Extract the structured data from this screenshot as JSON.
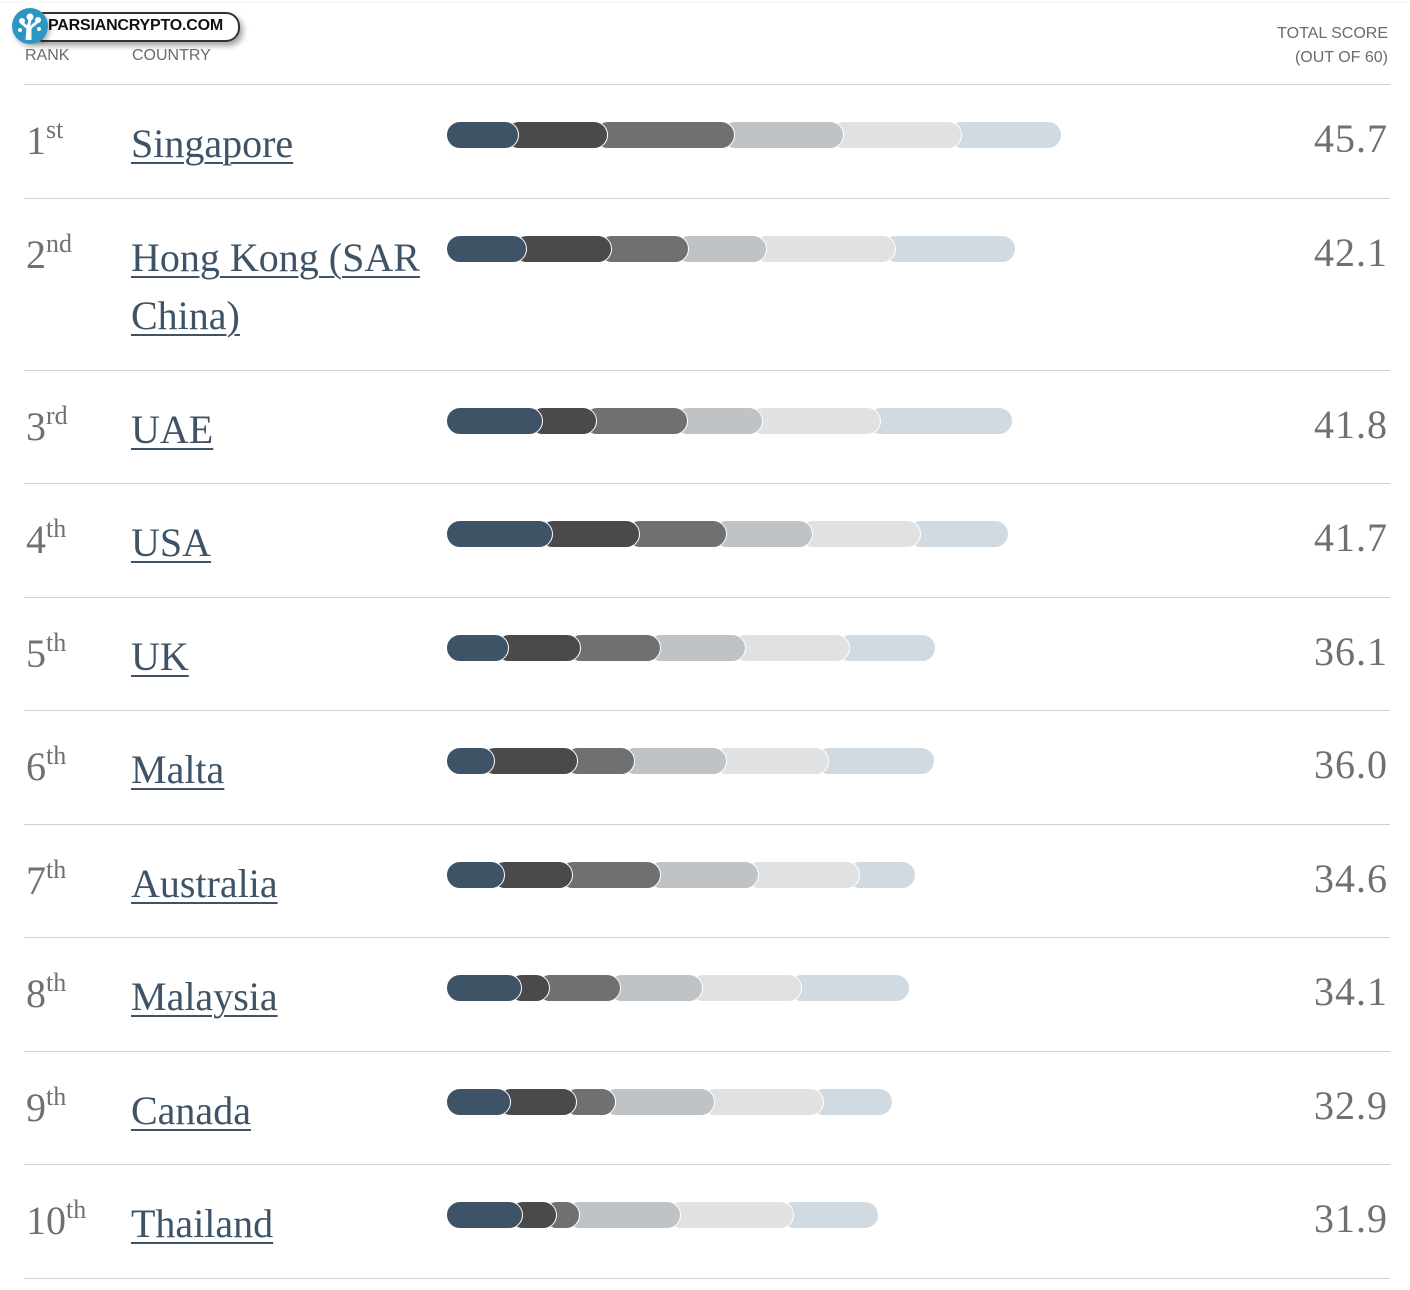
{
  "logo": {
    "text": "PARSIANCRYPTO.COM"
  },
  "header": {
    "rank": "RANK",
    "country": "COUNTRY",
    "score_line1": "TOTAL SCORE",
    "score_line2": "(OUT OF 60)"
  },
  "chart_data": {
    "type": "bar",
    "stacked": true,
    "orientation": "horizontal",
    "xlim": [
      0,
      60
    ],
    "segment_colors": [
      "#3f5366",
      "#4a4a4c",
      "#6f7071",
      "#c0c3c6",
      "#e0e1e2",
      "#d2dae1"
    ],
    "rows": [
      {
        "rank": "1",
        "suffix": "st",
        "country": "Singapore",
        "score": "45.7",
        "segments": [
          5.4,
          6.6,
          9.4,
          8.1,
          8.7,
          7.4
        ]
      },
      {
        "rank": "2",
        "suffix": "nd",
        "country": "Hong Kong (SAR China)",
        "score": "42.1",
        "segments": [
          6.0,
          6.3,
          5.7,
          5.8,
          9.5,
          8.9
        ]
      },
      {
        "rank": "3",
        "suffix": "rd",
        "country": "UAE",
        "score": "41.8",
        "segments": [
          7.2,
          4.0,
          6.7,
          5.6,
          8.7,
          9.8
        ]
      },
      {
        "rank": "4",
        "suffix": "th",
        "country": "USA",
        "score": "41.7",
        "segments": [
          7.9,
          6.5,
          6.4,
          6.4,
          8.0,
          6.5
        ]
      },
      {
        "rank": "5",
        "suffix": "th",
        "country": "UK",
        "score": "36.1",
        "segments": [
          4.7,
          5.3,
          5.9,
          6.3,
          7.7,
          6.4
        ]
      },
      {
        "rank": "6",
        "suffix": "th",
        "country": "Malta",
        "score": "36.0",
        "segments": [
          3.6,
          6.2,
          4.2,
          6.8,
          7.6,
          7.8
        ]
      },
      {
        "rank": "7",
        "suffix": "th",
        "country": "Australia",
        "score": "34.6",
        "segments": [
          4.4,
          5.0,
          6.5,
          7.3,
          7.5,
          4.1
        ]
      },
      {
        "rank": "8",
        "suffix": "th",
        "country": "Malaysia",
        "score": "34.1",
        "segments": [
          5.6,
          2.1,
          5.3,
          6.0,
          7.4,
          8.0
        ]
      },
      {
        "rank": "9",
        "suffix": "th",
        "country": "Canada",
        "score": "32.9",
        "segments": [
          4.8,
          4.9,
          2.9,
          7.3,
          8.1,
          5.1
        ]
      },
      {
        "rank": "10",
        "suffix": "th",
        "country": "Thailand",
        "score": "31.9",
        "segments": [
          5.7,
          2.5,
          1.7,
          7.5,
          8.4,
          6.3
        ]
      }
    ]
  }
}
